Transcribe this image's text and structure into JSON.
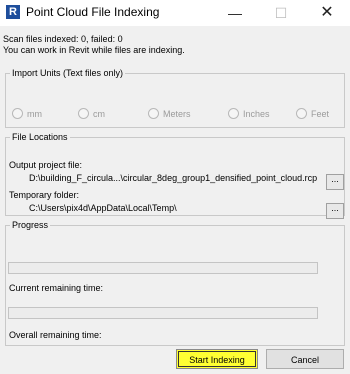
{
  "window": {
    "title": "Point Cloud File Indexing",
    "icon_letter": "R",
    "minimize_glyph": "—",
    "maximize_glyph": "☐",
    "close_glyph": "✕"
  },
  "status": {
    "line1": "Scan files indexed: 0, failed: 0",
    "line2": "You can work in Revit while files are indexing."
  },
  "import_units": {
    "legend": "Import Units (Text files only)",
    "options": [
      "mm",
      "cm",
      "Meters",
      "Inches",
      "Feet"
    ],
    "enabled": false
  },
  "file_locations": {
    "legend": "File Locations",
    "output_label": "Output project file:",
    "output_value": "D:\\building_F_circula...\\circular_8deg_group1_densified_point_cloud.rcp",
    "temp_label": "Temporary folder:",
    "temp_value": "C:\\Users\\pix4d\\AppData\\Local\\Temp\\",
    "browse_label": "..."
  },
  "progress": {
    "legend": "Progress",
    "bar1_fraction": 0,
    "current_label": "Current remaining time:",
    "bar2_fraction": 0,
    "overall_label": "Overall remaining time:"
  },
  "buttons": {
    "start": "Start Indexing",
    "cancel": "Cancel"
  },
  "colors": {
    "start_button_highlight": "#ffff33",
    "progress_fill": "#06b025"
  }
}
